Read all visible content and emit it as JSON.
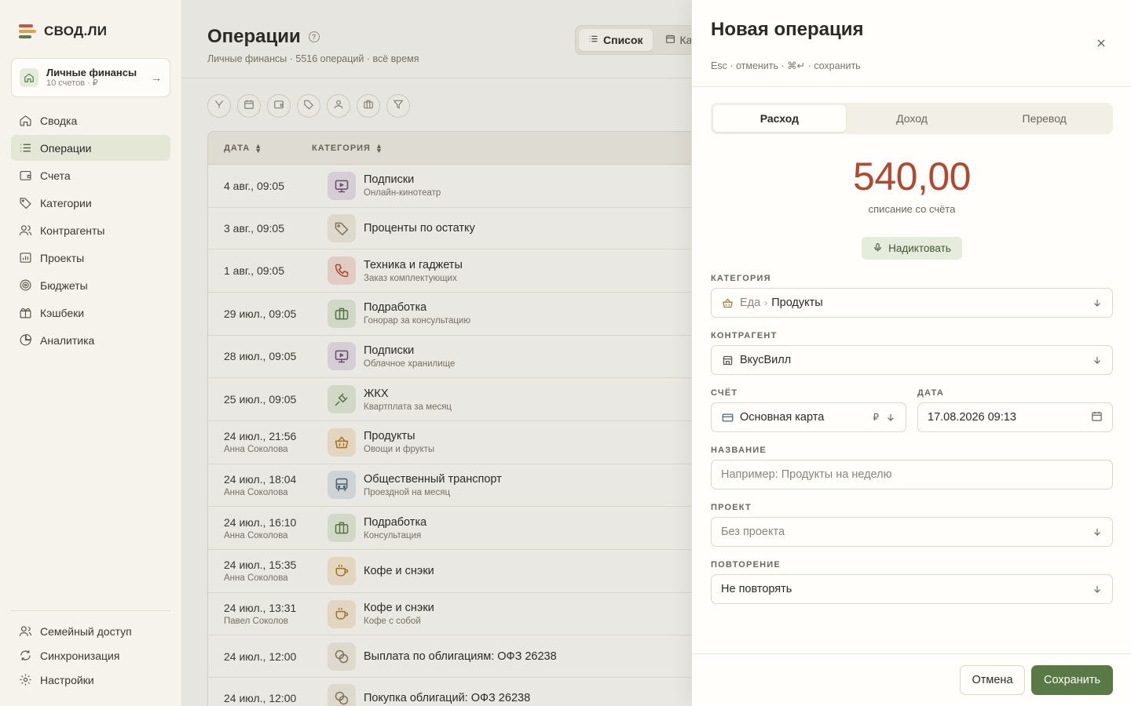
{
  "app": {
    "logo_text": "СВОД.ЛИ"
  },
  "workspace": {
    "name": "Личные финансы",
    "sub": "10 счетов · ₽"
  },
  "nav": [
    {
      "label": "Сводка",
      "icon": "home-icon",
      "active": false
    },
    {
      "label": "Операции",
      "icon": "list-icon",
      "active": true
    },
    {
      "label": "Счета",
      "icon": "wallet-icon",
      "active": false
    },
    {
      "label": "Категории",
      "icon": "tag-icon",
      "active": false
    },
    {
      "label": "Контрагенты",
      "icon": "users-icon",
      "active": false
    },
    {
      "label": "Проекты",
      "icon": "folder-chart-icon",
      "active": false
    },
    {
      "label": "Бюджеты",
      "icon": "target-icon",
      "active": false
    },
    {
      "label": "Кэшбеки",
      "icon": "gift-icon",
      "active": false
    },
    {
      "label": "Аналитика",
      "icon": "pie-chart-icon",
      "active": false
    }
  ],
  "nav_bottom": [
    {
      "label": "Семейный доступ",
      "icon": "family-icon"
    },
    {
      "label": "Синхронизация",
      "icon": "sync-icon"
    },
    {
      "label": "Настройки",
      "icon": "gear-icon"
    }
  ],
  "page": {
    "title": "Операции",
    "subtitle": "Личные финансы · 5516 операций · всё время",
    "view_list": "Список",
    "view_calendar": "Кал"
  },
  "table": {
    "col_date": "ДАТА",
    "col_category": "КАТЕГОРИЯ",
    "rows": [
      {
        "date": "4 авг., 09:05",
        "who": "",
        "cat": "Подписки",
        "note": "Онлайн-кинотеатр",
        "icon": "monitor-icon",
        "bg": "#e8dfe9",
        "fg": "#6d4d73"
      },
      {
        "date": "3 авг., 09:05",
        "who": "",
        "cat": "Проценты по остатку",
        "note": "",
        "icon": "tag-icon",
        "bg": "#f1ebe0",
        "fg": "#8a7a5e"
      },
      {
        "date": "1 авг., 09:05",
        "who": "",
        "cat": "Техника и гаджеты",
        "note": "Заказ комплектующих",
        "icon": "phone-icon",
        "bg": "#f4ddd5",
        "fg": "#b4482f"
      },
      {
        "date": "29 июл., 09:05",
        "who": "",
        "cat": "Подработка",
        "note": "Гонорар за консультацию",
        "icon": "briefcase-icon",
        "bg": "#e4ead9",
        "fg": "#5a7a45"
      },
      {
        "date": "28 июл., 09:05",
        "who": "",
        "cat": "Подписки",
        "note": "Облачное хранилище",
        "icon": "monitor-icon",
        "bg": "#e8dfe9",
        "fg": "#6d4d73"
      },
      {
        "date": "25 июл., 09:05",
        "who": "",
        "cat": "ЖКХ",
        "note": "Квартплата за месяц",
        "icon": "plug-icon",
        "bg": "#e4ead9",
        "fg": "#5a7a45"
      },
      {
        "date": "24 июл., 21:56",
        "who": "Анна Соколова",
        "cat": "Продукты",
        "note": "Овощи и фрукты",
        "icon": "basket-icon",
        "bg": "#f5e8d2",
        "fg": "#b07a24"
      },
      {
        "date": "24 июл., 18:04",
        "who": "Анна Соколова",
        "cat": "Общественный транспорт",
        "note": "Проездной на месяц",
        "icon": "bus-icon",
        "bg": "#dfe5ea",
        "fg": "#4f6577"
      },
      {
        "date": "24 июл., 16:10",
        "who": "Анна Соколова",
        "cat": "Подработка",
        "note": "Консультация",
        "icon": "briefcase-icon",
        "bg": "#e4ead9",
        "fg": "#5a7a45"
      },
      {
        "date": "24 июл., 15:35",
        "who": "Анна Соколова",
        "cat": "Кофе и снэки",
        "note": "",
        "icon": "coffee-icon",
        "bg": "#f5e8d2",
        "fg": "#b07a24"
      },
      {
        "date": "24 июл., 13:31",
        "who": "Павел Соколов",
        "cat": "Кофе и снэки",
        "note": "Кофе с собой",
        "icon": "coffee-icon",
        "bg": "#f5e8d2",
        "fg": "#b07a24"
      },
      {
        "date": "24 июл., 12:00",
        "who": "",
        "cat": "Выплата по облигациям: ОФЗ 26238",
        "note": "",
        "icon": "coins-icon",
        "bg": "#f1ebe0",
        "fg": "#8a7a5e"
      },
      {
        "date": "24 июл., 12:00",
        "who": "",
        "cat": "Покупка облигаций: ОФЗ 26238",
        "note": "",
        "icon": "coins-icon",
        "bg": "#f1ebe0",
        "fg": "#8a7a5e"
      }
    ]
  },
  "drawer": {
    "title": "Новая операция",
    "hint": "Esc · отменить · ⌘↵ · сохранить",
    "tabs": [
      "Расход",
      "Доход",
      "Перевод"
    ],
    "active_tab": "Расход",
    "amount": "540,00",
    "amount_caption": "списание со счёта",
    "dictate_label": "Надиктовать",
    "category_label": "КАТЕГОРИЯ",
    "category_parent": "Еда",
    "category_value": "Продукты",
    "counterparty_label": "КОНТРАГЕНТ",
    "counterparty_value": "ВкусВилл",
    "account_label": "СЧЁТ",
    "account_value": "Основная карта",
    "account_currency": "₽",
    "date_label": "ДАТА",
    "date_value": "17.08.2026 09:13",
    "name_label": "НАЗВАНИЕ",
    "name_placeholder": "Например: Продукты на неделю",
    "project_label": "ПРОЕКТ",
    "project_value": "Без проекта",
    "repeat_label": "ПОВТОРЕНИЕ",
    "repeat_value": "Не повторять",
    "cancel_label": "Отмена",
    "save_label": "Сохранить"
  },
  "colors": {
    "accent": "#5a7a45",
    "expense": "#b4482f",
    "sidebar_active": "#e4e7d6"
  }
}
